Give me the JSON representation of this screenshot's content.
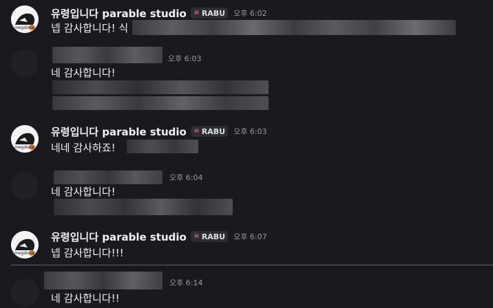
{
  "messages": [
    {
      "author": "유령입니다 parable studio",
      "tag": "RABU",
      "time": "오후 6:02",
      "text": "넵 감사합니다! 식"
    },
    {
      "time": "오후 6:03",
      "text": "네 감사합니다!"
    },
    {
      "author": "유령입니다 parable studio",
      "tag": "RABU",
      "time": "오후 6:03",
      "text": "네네 감사하죠!"
    },
    {
      "time": "오후 6:04",
      "text": "네 감사합니다!"
    },
    {
      "author": "유령입니다 parable studio",
      "tag": "RABU",
      "time": "오후 6:07",
      "text": "넵 감사합니다!!!"
    },
    {
      "time": "오후 6:14",
      "text": "네 감사합니다!!"
    }
  ],
  "avatar_label": "megdonal",
  "colors": {
    "background": "#1a1a1e",
    "tag_skull": "#ff79b6",
    "new_divider": "#c0393f",
    "timestamp": "#949ba4"
  },
  "icons": {
    "tag": "pink-skull-icon"
  }
}
